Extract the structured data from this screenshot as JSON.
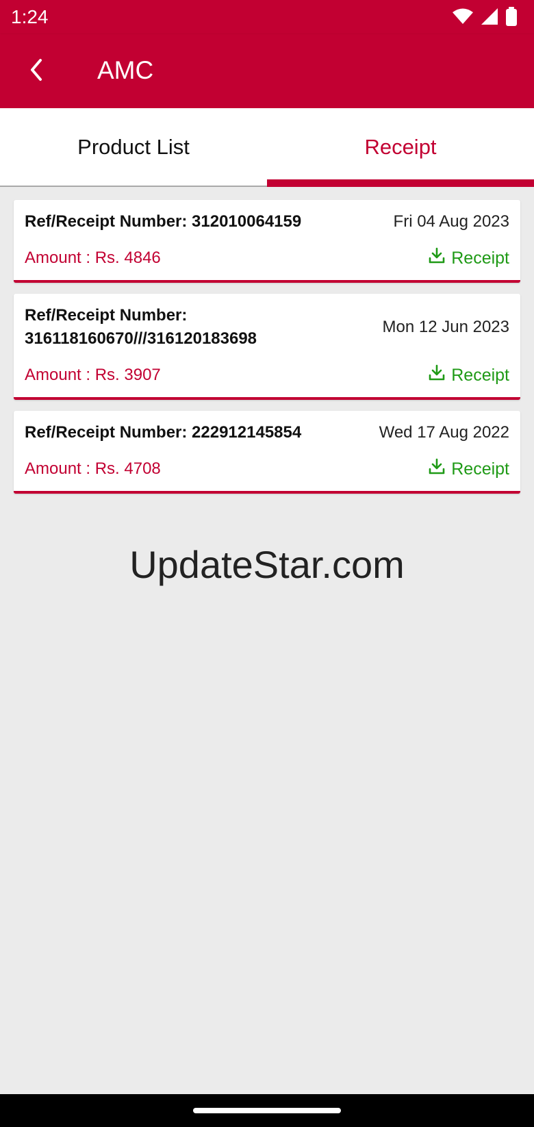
{
  "status_bar": {
    "time": "1:24",
    "icons": [
      "wifi-icon",
      "signal-icon",
      "battery-icon"
    ]
  },
  "app_bar": {
    "back_icon": "chevron-left-icon",
    "title": "AMC"
  },
  "tabs": [
    {
      "label": "Product List",
      "selected": false
    },
    {
      "label": "Receipt",
      "selected": true
    }
  ],
  "receipts": [
    {
      "ref_line1": "Ref/Receipt Number: 312010064159",
      "ref_line2": "",
      "date": "Fri 04 Aug 2023",
      "amount": "Amount : Rs. 4846",
      "link_label": "Receipt"
    },
    {
      "ref_line1": "Ref/Receipt Number:",
      "ref_line2": "316118160670///316120183698",
      "date": "Mon 12 Jun 2023",
      "amount": "Amount : Rs. 3907",
      "link_label": "Receipt"
    },
    {
      "ref_line1": "Ref/Receipt Number: 222912145854",
      "ref_line2": "",
      "date": "Wed 17 Aug 2022",
      "amount": "Amount : Rs. 4708",
      "link_label": "Receipt"
    }
  ],
  "watermark": "UpdateStar.com",
  "colors": {
    "brand": "#c20032",
    "link": "#1f9a16",
    "background": "#ebebeb"
  }
}
